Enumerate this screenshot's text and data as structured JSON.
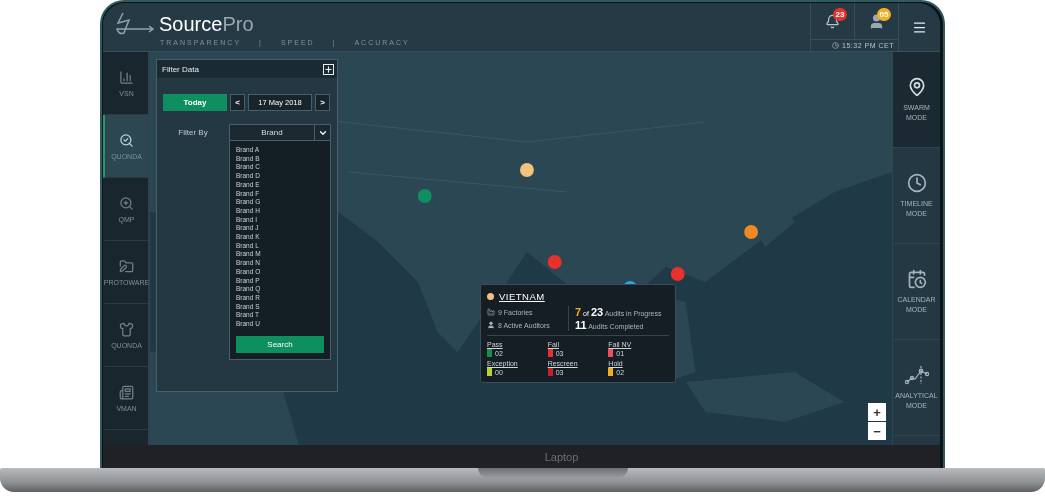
{
  "header": {
    "logo": {
      "name": "Source",
      "suffix": "Pro"
    },
    "tagline": [
      "TRANSPARENCY",
      "|",
      "SPEED",
      "|",
      "ACCURACY"
    ],
    "notifications": {
      "count": "23"
    },
    "user": {
      "badge": "05"
    },
    "time": "15:32 PM CET"
  },
  "left_nav": [
    {
      "label": "VSN",
      "selected": false
    },
    {
      "label": "QUONDA",
      "selected": true
    },
    {
      "label": "QMP",
      "selected": false
    },
    {
      "label": "PROTOWARE",
      "selected": false
    },
    {
      "label": "QUONDA",
      "selected": false
    },
    {
      "label": "VMAN",
      "selected": false
    }
  ],
  "right_nav": [
    {
      "label": "SWARM MODE",
      "selected": true
    },
    {
      "label": "TIMELINE MODE",
      "selected": false
    },
    {
      "label": "CALENDAR MODE",
      "selected": false
    },
    {
      "label": "ANALYTICAL MODE",
      "selected": false
    }
  ],
  "filter_panel": {
    "title": "Filter Data",
    "today": "Today",
    "prev": "<",
    "date": "17 May 2018",
    "next": ">",
    "filter_by_label": "Filter By",
    "dropdown": "Brand",
    "brands": [
      "Brand A",
      "Brand B",
      "Brand C",
      "Brand D",
      "Brand E",
      "Brand F",
      "Brand G",
      "Brand H",
      "Brand I",
      "Brand J",
      "Brand K",
      "Brand L",
      "Brand M",
      "Brand N",
      "Brand O",
      "Brand P",
      "Brand Q",
      "Brand R",
      "Brand S",
      "Brand T",
      "Brand U"
    ],
    "search": "Search"
  },
  "popup": {
    "country": "VIETNAM",
    "color": "#f3c27e",
    "factories": "9 Factories",
    "auditors": "8 Active Auditors",
    "in_progress": {
      "count": "7",
      "of": "of",
      "total": "23",
      "label": "Audits in Progress"
    },
    "completed": {
      "count": "11",
      "label": "Audits Completed"
    },
    "results": [
      {
        "label": "Pass",
        "value": "02",
        "color": "#1e8a4a"
      },
      {
        "label": "Fail",
        "value": "03",
        "color": "#e8312a"
      },
      {
        "label": "Fail NV",
        "value": "01",
        "color": "#ef4f5a"
      },
      {
        "label": "Exception",
        "value": "00",
        "color": "#b5d334"
      },
      {
        "label": "Rescreen",
        "value": "03",
        "color": "#c8202a"
      },
      {
        "label": "Hold",
        "value": "02",
        "color": "#f2b01e"
      }
    ]
  },
  "zoom": {
    "in": "+",
    "out": "−"
  },
  "device": {
    "label": "Laptop"
  }
}
